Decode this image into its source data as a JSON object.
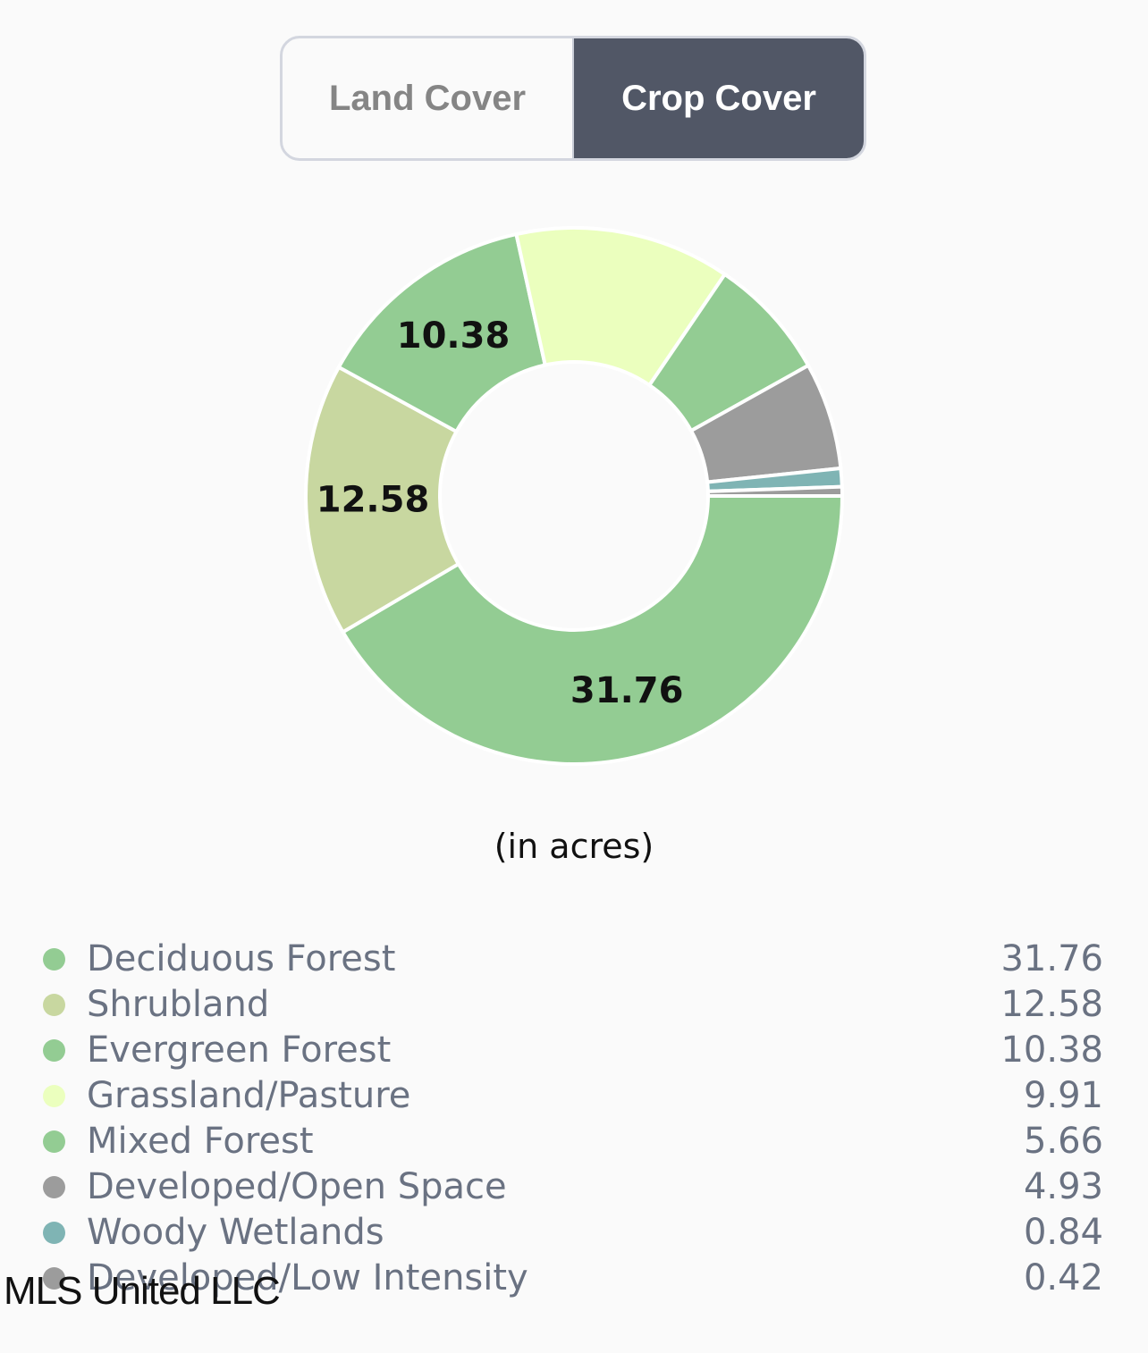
{
  "toggle": {
    "options": [
      "Land Cover",
      "Crop Cover"
    ],
    "selected": "Crop Cover"
  },
  "chart_data": {
    "type": "pie",
    "donut": true,
    "categories": [
      "Deciduous Forest",
      "Shrubland",
      "Evergreen Forest",
      "Grassland/Pasture",
      "Mixed Forest",
      "Developed/Open Space",
      "Woody Wetlands",
      "Developed/Low Intensity"
    ],
    "values": [
      31.76,
      12.58,
      10.38,
      9.91,
      5.66,
      4.93,
      0.84,
      0.42
    ],
    "colors": [
      "#93cc93",
      "#c8d7a0",
      "#93cc93",
      "#ebffbe",
      "#93cc93",
      "#9c9c9c",
      "#7fb4b4",
      "#9c9c9c"
    ],
    "data_labels": [
      "31.76",
      "12.58",
      "10.38",
      "",
      "",
      "",
      "",
      ""
    ],
    "unit_label": "(in acres)",
    "legend_placement": "bottom"
  },
  "watermark": "MLS United LLC"
}
